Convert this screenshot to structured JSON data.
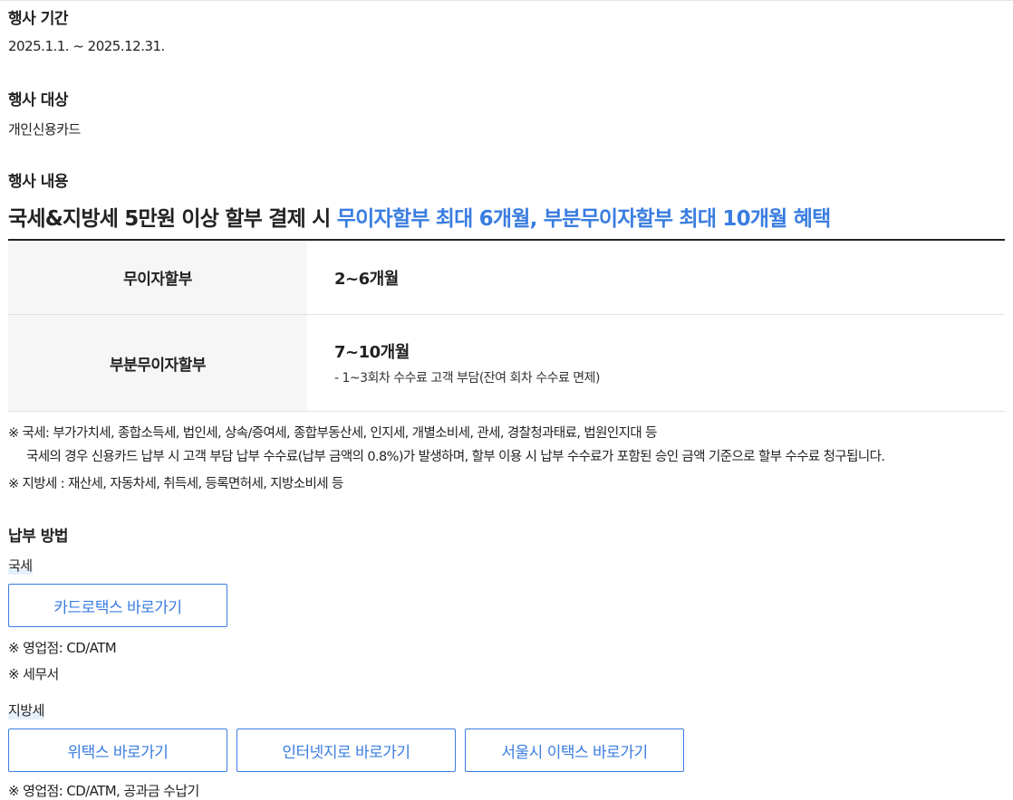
{
  "period": {
    "heading": "행사 기간",
    "value": "2025.1.1. ~ 2025.12.31."
  },
  "target": {
    "heading": "행사 대상",
    "value": "개인신용카드"
  },
  "content": {
    "heading": "행사 내용",
    "headline_black": "국세&지방세 5만원 이상 할부 결제 시 ",
    "headline_blue": "무이자할부 최대 6개월, 부분무이자할부 최대 10개월 혜택",
    "table": [
      {
        "label": "무이자할부",
        "value": "2~6개월",
        "sub": ""
      },
      {
        "label": "부분무이자할부",
        "value": "7~10개월",
        "sub": "- 1~3회차 수수료 고객 부담(잔여 회차 수수료 면제)"
      }
    ],
    "notes": [
      "※ 국세: 부가가치세, 종합소득세, 법인세, 상속/증여세, 종합부동산세, 인지세, 개별소비세, 관세, 경찰청과태료, 법원인지대 등",
      "국세의 경우 신용카드 납부 시 고객 부담 납부 수수료(납부 금액의 0.8%)가 발생하며, 할부 이용 시 납부 수수료가 포함된 승인 금액 기준으로 할부 수수료 청구됩니다.",
      "※ 지방세 : 재산세, 자동차세, 취득세, 등록면허세, 지방소비세 등"
    ]
  },
  "payment": {
    "heading": "납부 방법",
    "national": {
      "label": "국세",
      "buttons": [
        "카드로택스 바로가기"
      ],
      "notes": [
        "※ 영업점: CD/ATM",
        "※ 세무서"
      ]
    },
    "local": {
      "label": "지방세",
      "buttons": [
        "위택스 바로가기",
        "인터넷지로 바로가기",
        "서울시 이택스 바로가기"
      ],
      "notes": [
        "※ 영업점: CD/ATM, 공과금 수납기"
      ]
    }
  },
  "colors": {
    "accent": "#3a7de0",
    "text": "#222222",
    "table_header_bg": "#f6f6f6"
  }
}
